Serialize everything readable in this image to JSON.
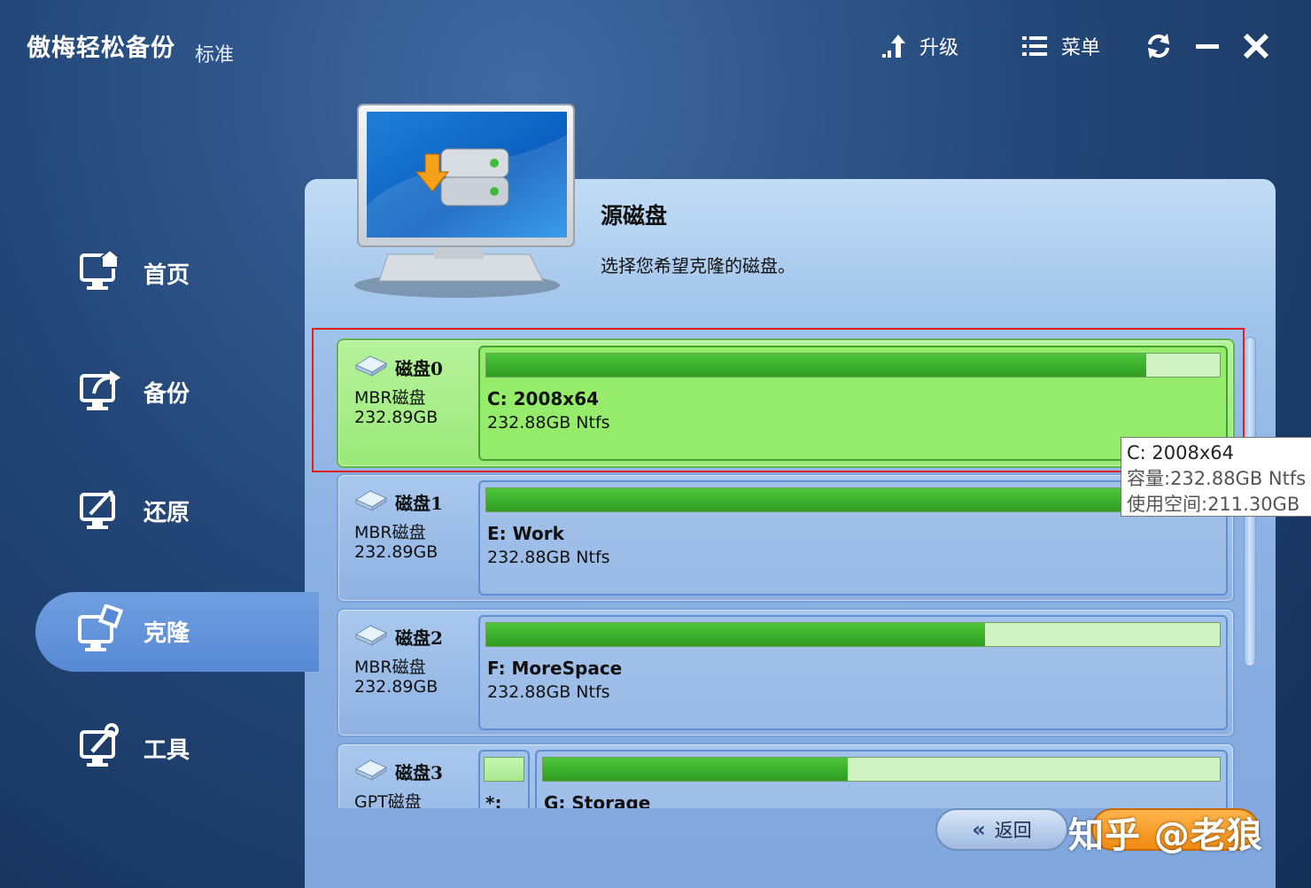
{
  "app": {
    "title": "傲梅轻松备份",
    "edition": "标准"
  },
  "toolbar": {
    "upgrade_label": "升级",
    "menu_label": "菜单"
  },
  "nav": {
    "items": [
      {
        "label": "首页",
        "icon": "home-monitor-icon"
      },
      {
        "label": "备份",
        "icon": "backup-monitor-icon"
      },
      {
        "label": "还原",
        "icon": "restore-monitor-icon"
      },
      {
        "label": "克隆",
        "icon": "clone-monitor-icon",
        "active": true
      },
      {
        "label": "工具",
        "icon": "tools-monitor-icon"
      }
    ]
  },
  "main": {
    "title": "源磁盘",
    "description": "选择您希望克隆的磁盘。",
    "disks": [
      {
        "name": "磁盘0",
        "type": "MBR磁盘",
        "size": "232.89GB",
        "partition_label": "C: 2008x64",
        "partition_size": "232.88GB Ntfs",
        "usage": 0.9,
        "selected": true
      },
      {
        "name": "磁盘1",
        "type": "MBR磁盘",
        "size": "232.89GB",
        "partition_label": "E: Work",
        "partition_size": "232.88GB Ntfs",
        "usage": 0.9
      },
      {
        "name": "磁盘2",
        "type": "MBR磁盘",
        "size": "232.89GB",
        "partition_label": "F: MoreSpace",
        "partition_size": "232.88GB Ntfs",
        "usage": 0.68
      },
      {
        "name": "磁盘3",
        "type": "GPT磁盘",
        "small_partition_label": "*:",
        "partition_label": "G: Storage",
        "usage": 0.45
      }
    ],
    "tooltip": {
      "title": "C: 2008x64",
      "capacity": "容量:232.88GB Ntfs",
      "used": "使用空间:211.30GB"
    },
    "back_label": "返回"
  },
  "watermark": "知乎 @老狼",
  "colors": {
    "accent_green": "#2f9d22",
    "selected_card": "#9bea7a",
    "nav_active": "#5789d4",
    "next_orange": "#f08a12"
  }
}
